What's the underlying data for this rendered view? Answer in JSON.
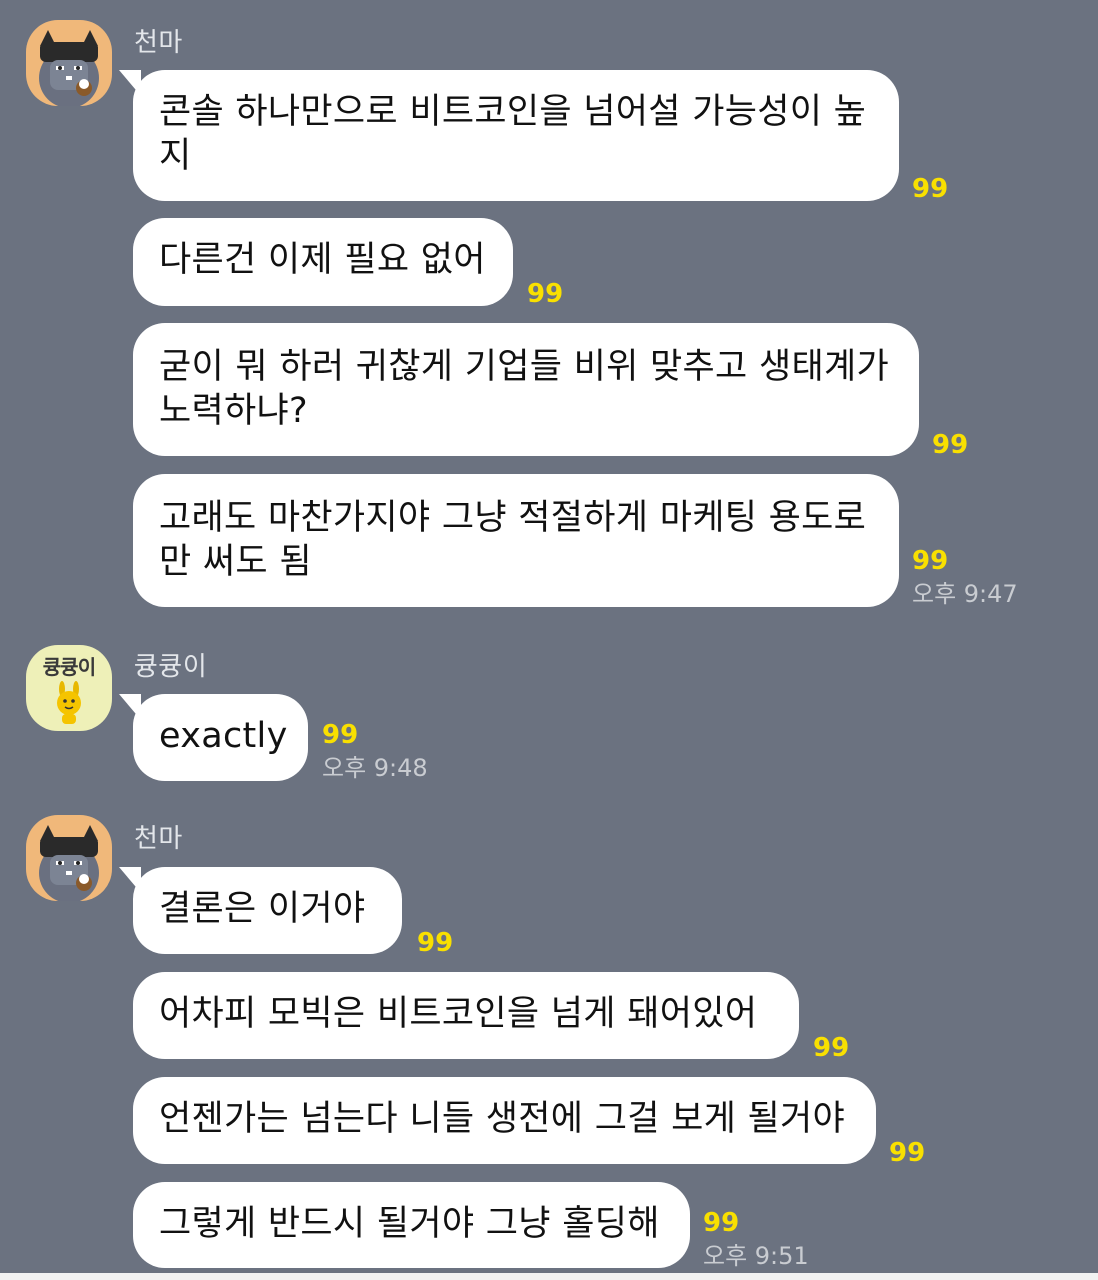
{
  "groups": [
    {
      "sender": "천마",
      "avatar_icon": "cat-with-hood-avatar-icon",
      "messages": [
        {
          "text_lines": [
            "콘솔 하나만으로 비트코인을 넘어설 가능성이 높",
            "지"
          ],
          "unread": "99",
          "time": ""
        },
        {
          "text_lines": [
            "다른건 이제 필요 없어"
          ],
          "unread": "99",
          "time": ""
        },
        {
          "text_lines": [
            "굳이 뭐 하러 귀찮게 기업들 비위 맞추고 생태계가",
            "노력하냐?"
          ],
          "unread": "99",
          "time": ""
        },
        {
          "text_lines": [
            "고래도 마찬가지야 그냥 적절하게 마케팅 용도로",
            "만 써도 됨"
          ],
          "unread": "99",
          "time": "오후 9:47"
        }
      ]
    },
    {
      "sender": "큥큥이",
      "avatar_label": "큥큥이",
      "avatar_icon": "yellow-bunny-avatar-icon",
      "messages": [
        {
          "text_lines": [
            "exactly"
          ],
          "unread": "99",
          "time": "오후 9:48"
        }
      ]
    },
    {
      "sender": "천마",
      "avatar_icon": "cat-with-hood-avatar-icon",
      "messages": [
        {
          "text_lines": [
            "결론은 이거야"
          ],
          "unread": "99",
          "time": ""
        },
        {
          "text_lines": [
            "어차피 모빅은 비트코인을 넘게 돼어있어"
          ],
          "unread": "99",
          "time": ""
        },
        {
          "text_lines": [
            "언젠가는 넘는다 니들 생전에 그걸 보게 될거야"
          ],
          "unread": "99",
          "time": ""
        },
        {
          "text_lines": [
            "그렇게 반드시 될거야 그냥 홀딩해"
          ],
          "unread": "99",
          "time": "오후 9:51"
        }
      ]
    }
  ],
  "colors": {
    "background": "#6b7280",
    "bubble": "#ffffff",
    "unread": "#f9e000",
    "time": "#c9ccd1",
    "sender": "#e3e6ea"
  }
}
